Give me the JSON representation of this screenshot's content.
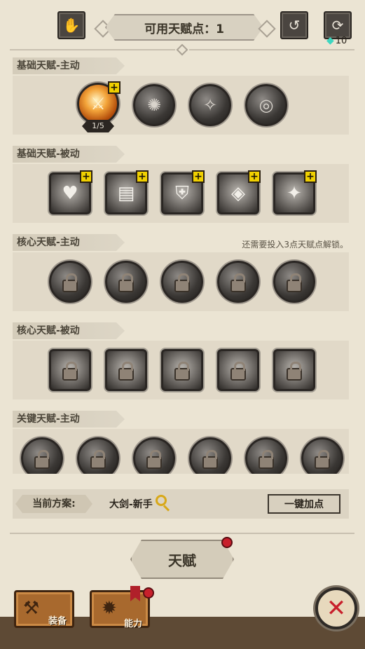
{
  "header": {
    "title": "可用天赋点：1",
    "currency_count": "10"
  },
  "sections": [
    {
      "title": "基础天赋-主动",
      "note": ""
    },
    {
      "title": "基础天赋-被动",
      "note": ""
    },
    {
      "title": "核心天赋-主动",
      "note": "还需要投入3点天赋点解锁。"
    },
    {
      "title": "核心天赋-被动",
      "note": ""
    },
    {
      "title": "关键天赋-主动",
      "note": ""
    }
  ],
  "active_skill_level": "1/5",
  "plus_symbol": "+",
  "plan": {
    "label": "当前方案:",
    "name": "大剑-新手",
    "auto_button": "一键加点"
  },
  "tabs": {
    "talent": "天赋",
    "equipment": "装备",
    "ability": "能力"
  },
  "icons": {
    "close": "✕"
  },
  "colors": {
    "accent_yellow": "#f0d000",
    "notification_red": "#c8202c",
    "active_orange": "#f3a43a",
    "gem_teal": "#3ed6c0"
  }
}
